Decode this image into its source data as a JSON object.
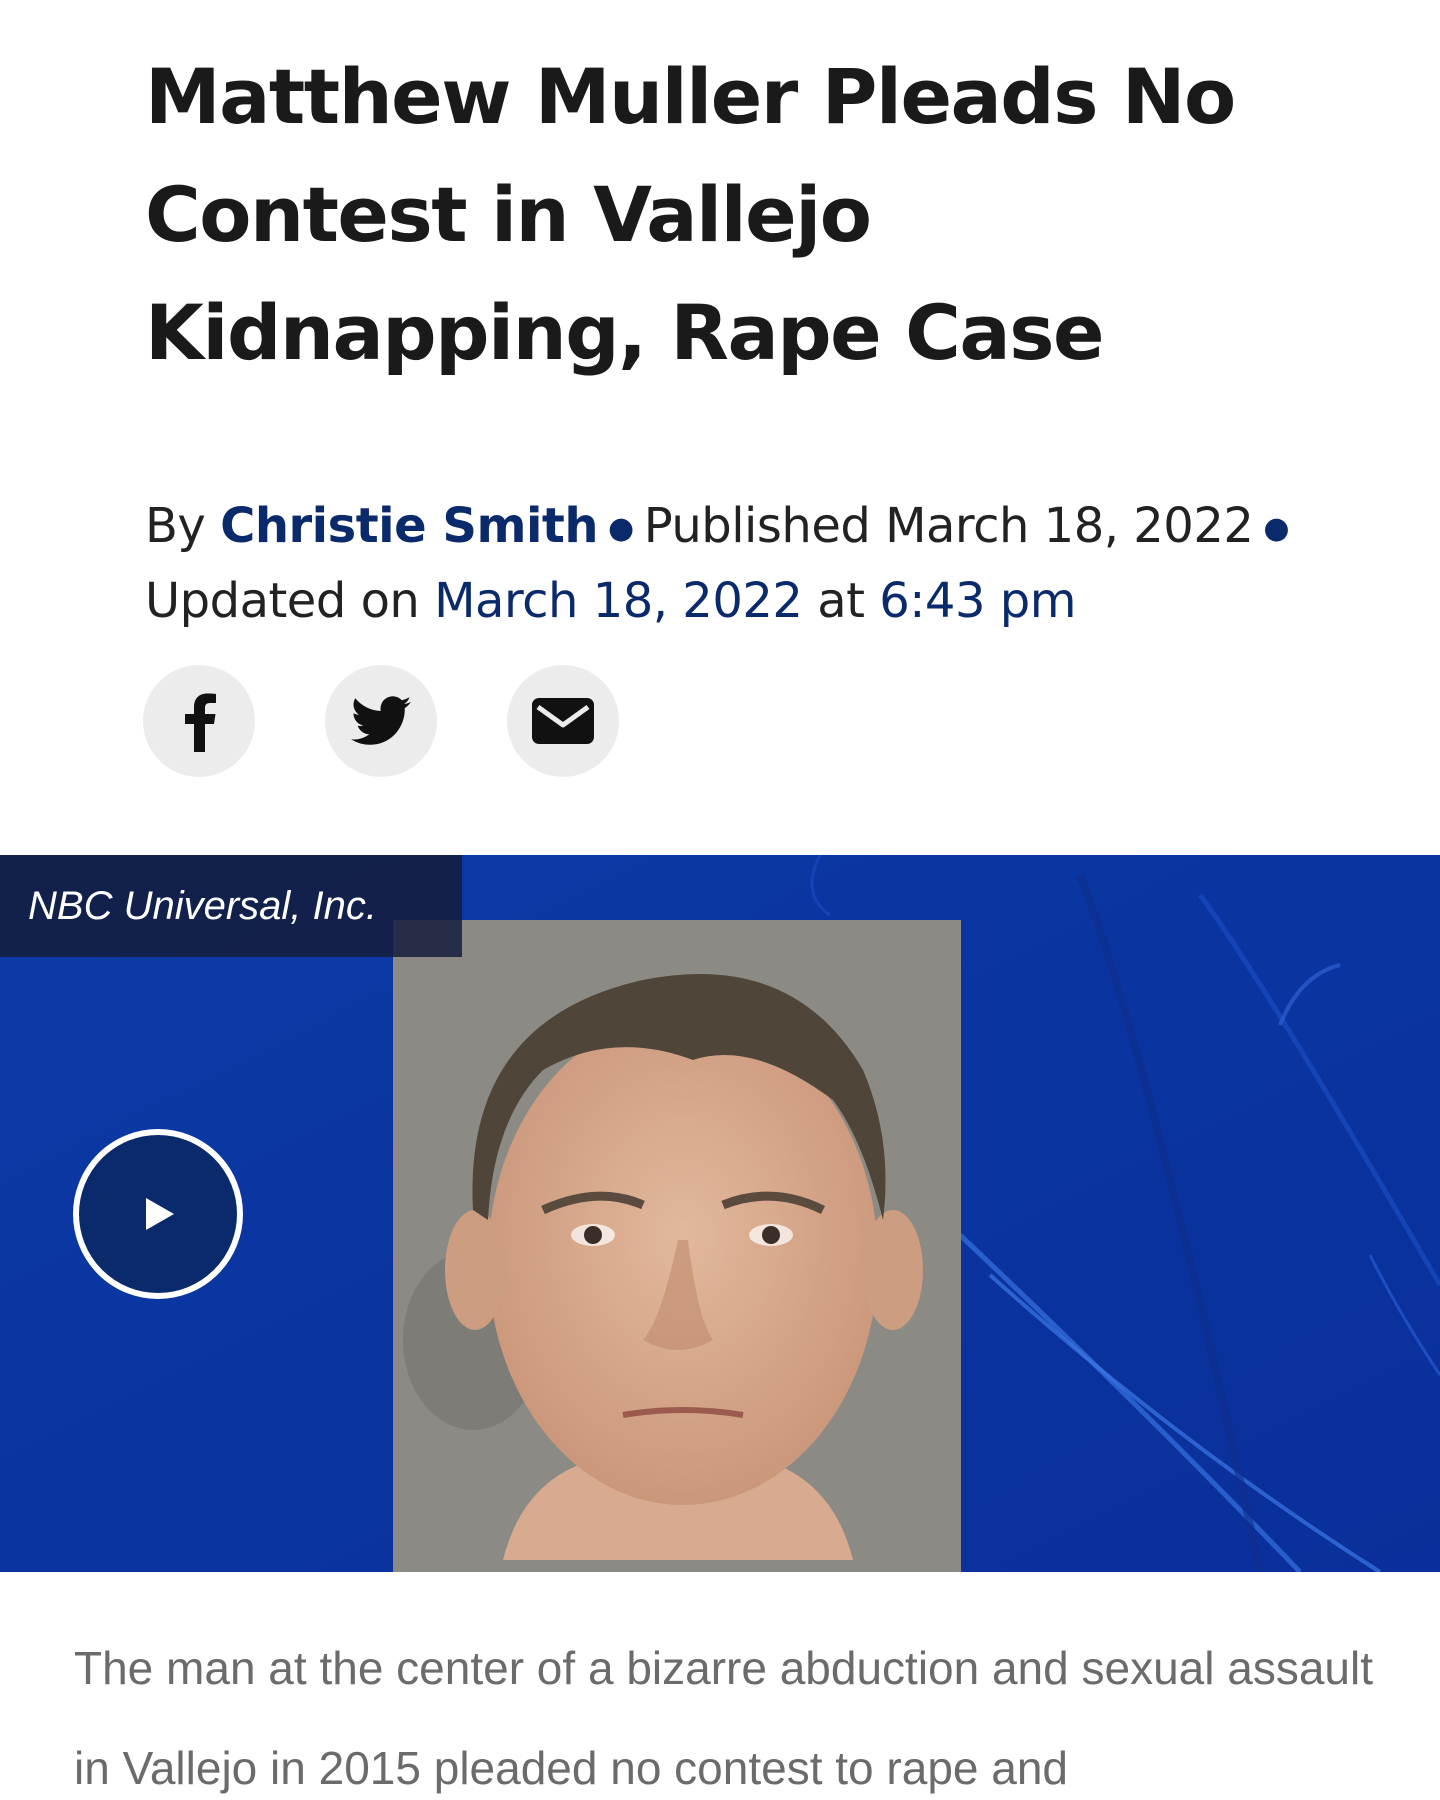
{
  "article": {
    "headline": "Matthew Muller Pleads No Contest in Vallejo Kidnapping, Rape Case",
    "byline": {
      "by": "By",
      "author": "Christie Smith",
      "published_label": "Published",
      "published_date": "March 18, 2022",
      "updated_label": "Updated on",
      "updated_date": "March 18, 2022",
      "at": "at",
      "updated_time": "6:43 pm"
    },
    "share": [
      {
        "icon": "facebook-icon"
      },
      {
        "icon": "twitter-icon"
      },
      {
        "icon": "email-icon"
      }
    ],
    "video": {
      "credit": "NBC Universal, Inc.",
      "play_icon": "play-icon"
    },
    "body_text": "The man at the center of a bizarre abduction and sexual assault in Vallejo in 2015 pleaded no contest to rape and"
  },
  "colors": {
    "accent": "#0b2a6b",
    "video_bg": "#0a3aa8",
    "share_bg": "#ececec",
    "body_text": "#6b6b6b"
  }
}
